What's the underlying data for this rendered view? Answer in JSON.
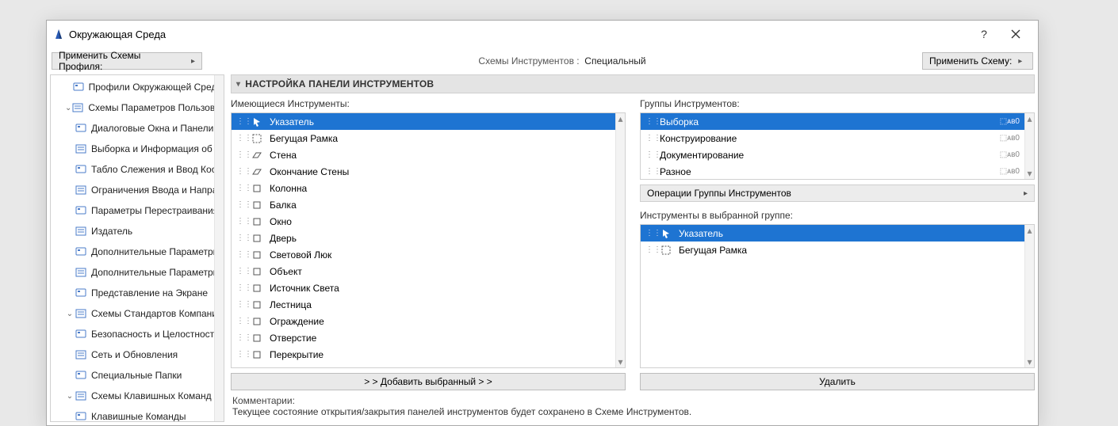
{
  "window": {
    "title": "Окружающая Среда"
  },
  "subbar": {
    "apply_profile": "Применить Схемы Профиля:",
    "crumb_label": "Схемы Инструментов :",
    "crumb_value": "Специальный",
    "apply_scheme": "Применить Схему:"
  },
  "sidebar": {
    "items": [
      {
        "level": 2,
        "label": "Профили Окружающей Среды",
        "expandable": false
      },
      {
        "level": 2,
        "label": "Схемы Параметров Пользователя",
        "expandable": true
      },
      {
        "level": 3,
        "label": "Диалоговые Окна и Панели"
      },
      {
        "level": 3,
        "label": "Выборка и Информация об Эле"
      },
      {
        "level": 3,
        "label": "Табло Слежения и Ввод Коорди"
      },
      {
        "level": 3,
        "label": "Ограничения Ввода и Направля"
      },
      {
        "level": 3,
        "label": "Параметры Перестраивания Мо"
      },
      {
        "level": 3,
        "label": "Издатель"
      },
      {
        "level": 3,
        "label": "Дополнительные Параметры"
      },
      {
        "level": 3,
        "label": "Дополнительные Параметры О"
      },
      {
        "level": 3,
        "label": "Представление на Экране"
      },
      {
        "level": 2,
        "label": "Схемы Стандартов Компании",
        "expandable": true
      },
      {
        "level": 3,
        "label": "Безопасность и Целостность да"
      },
      {
        "level": 3,
        "label": "Сеть и Обновления"
      },
      {
        "level": 3,
        "label": "Специальные Папки"
      },
      {
        "level": 2,
        "label": "Схемы Клавишных Команд",
        "expandable": true
      },
      {
        "level": 3,
        "label": "Клавишные Команды"
      }
    ]
  },
  "section": {
    "header": "НАСТРОЙКА ПАНЕЛИ ИНСТРУМЕНТОВ"
  },
  "left_col": {
    "label": "Имеющиеся Инструменты:",
    "items": [
      {
        "label": "Указатель",
        "selected": true
      },
      {
        "label": "Бегущая Рамка"
      },
      {
        "label": "Стена"
      },
      {
        "label": "Окончание Стены"
      },
      {
        "label": "Колонна"
      },
      {
        "label": "Балка"
      },
      {
        "label": "Окно"
      },
      {
        "label": "Дверь"
      },
      {
        "label": "Световой Люк"
      },
      {
        "label": "Объект"
      },
      {
        "label": "Источник Света"
      },
      {
        "label": "Лестница"
      },
      {
        "label": "Ограждение"
      },
      {
        "label": "Отверстие"
      },
      {
        "label": "Перекрытие"
      }
    ]
  },
  "right_col": {
    "groups_label": "Группы Инструментов:",
    "groups": [
      {
        "label": "Выборка",
        "selected": true,
        "badge": "⬚ᴀʙ0"
      },
      {
        "label": "Конструирование",
        "badge": "⬚ᴀʙ0"
      },
      {
        "label": "Документирование",
        "badge": "⬚ᴀʙ0"
      },
      {
        "label": "Разное",
        "badge": "⬚ᴀʙ0"
      }
    ],
    "groupops": "Операции Группы Инструментов",
    "tools_label": "Инструменты в выбранной группе:",
    "tools": [
      {
        "label": "Указатель",
        "selected": true
      },
      {
        "label": "Бегущая Рамка"
      }
    ]
  },
  "buttons": {
    "add": "> >  Добавить выбранный  > >",
    "remove": "Удалить"
  },
  "comments": {
    "label": "Комментарии:",
    "text": "Текущее состояние открытия/закрытия панелей инструментов будет сохранено в Схеме Инструментов."
  }
}
